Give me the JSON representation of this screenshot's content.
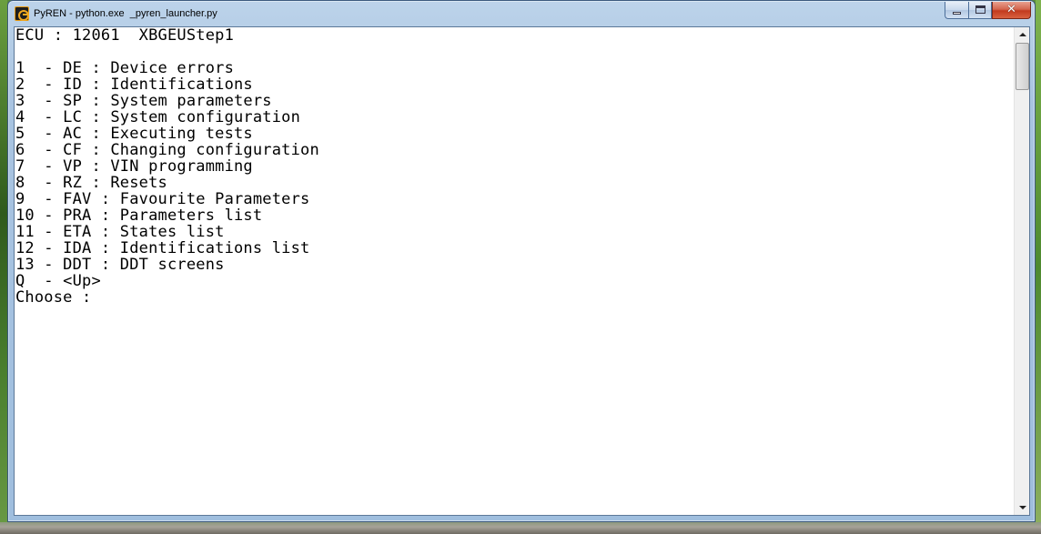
{
  "window": {
    "title": "PyREN - python.exe  _pyren_launcher.py",
    "icon": "pyren-app-icon",
    "buttons": {
      "minimize": "minimize",
      "maximize": "maximize",
      "close": "close"
    },
    "close_glyph": "✕"
  },
  "console": {
    "lines": [
      "ECU : 12061  XBGEUStep1",
      "",
      "1  - DE : Device errors",
      "2  - ID : Identifications",
      "3  - SP : System parameters",
      "4  - LC : System configuration",
      "5  - AC : Executing tests",
      "6  - CF : Changing configuration",
      "7  - VP : VIN programming",
      "8  - RZ : Resets",
      "9  - FAV : Favourite Parameters",
      "10 - PRA : Parameters list",
      "11 - ETA : States list",
      "12 - IDA : Identifications list",
      "13 - DDT : DDT screens",
      "Q  - <Up>",
      "Choose :"
    ]
  },
  "colors": {
    "console_background": "#ffffff",
    "console_text": "#000000",
    "titlebar": "#a9c4e1",
    "close_button": "#c23a1e"
  }
}
